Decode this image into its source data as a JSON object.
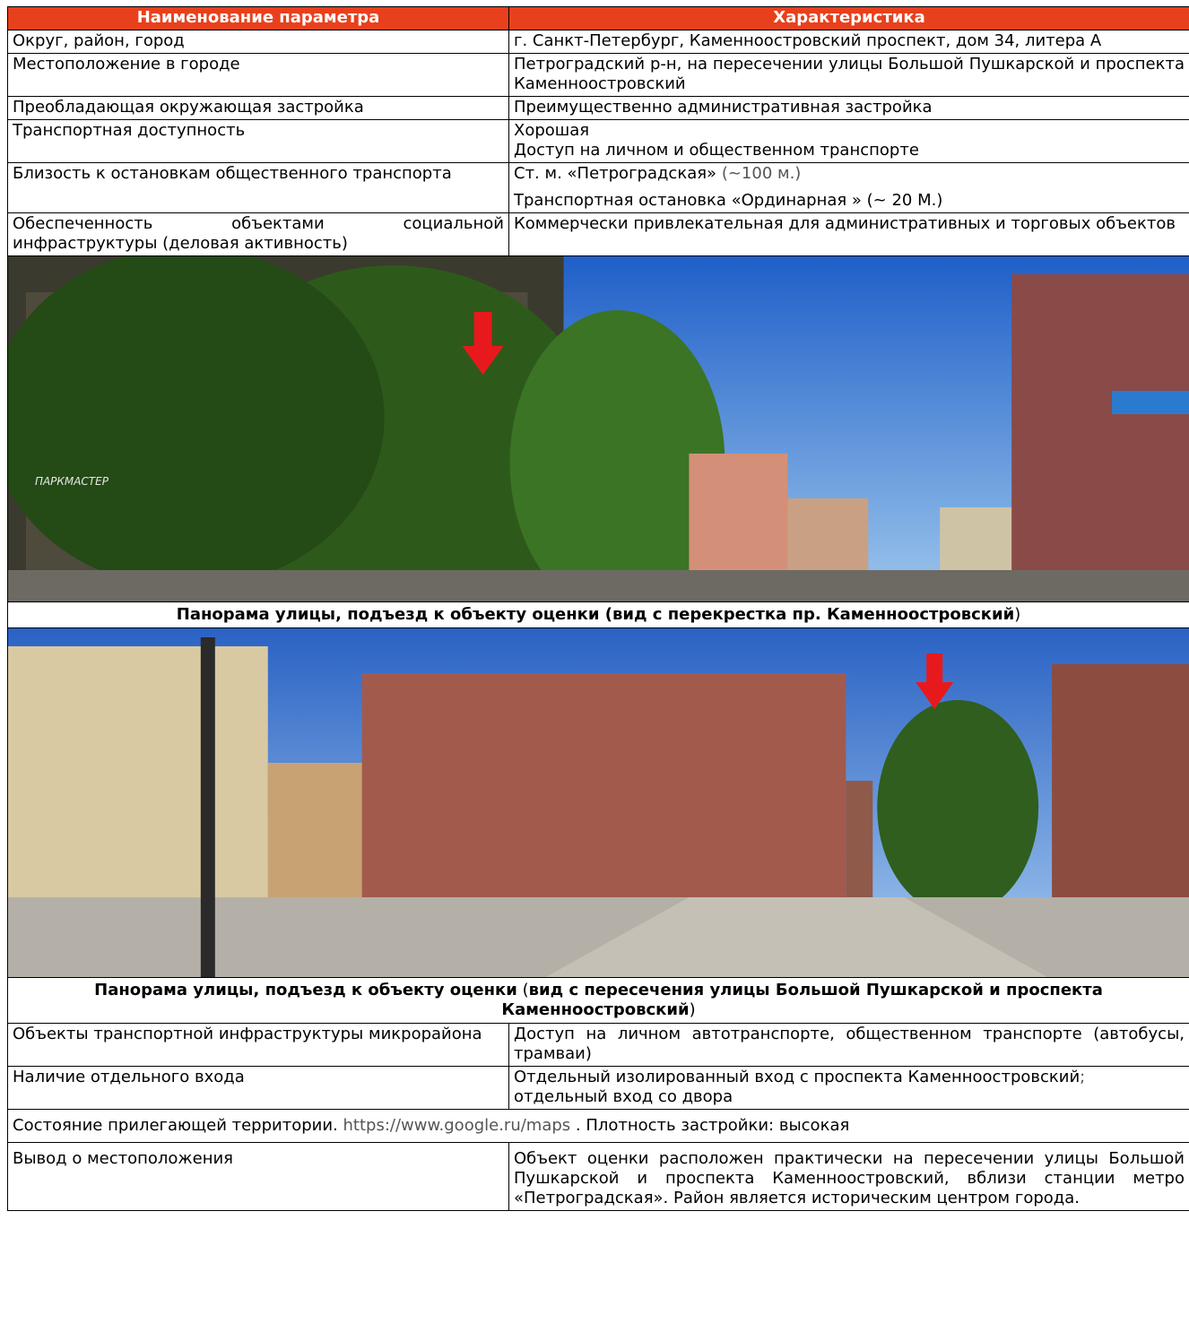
{
  "header": {
    "col1": "Наименование параметра",
    "col2": "Характеристика"
  },
  "rows_top": [
    {
      "param": "Округ, район, город",
      "value": "г. Санкт-Петербург, Каменноостровский проспект, дом 34, литера А"
    },
    {
      "param": "Местоположение в городе",
      "value": "Петроградский р-н, на пересечении улицы Большой Пушкарской  и проспекта Каменноостровский"
    },
    {
      "param": "Преобладающая окружающая застройка",
      "value": "Преимущественно  административная застройка"
    },
    {
      "param": "Транспортная доступность",
      "value_line1": "Хорошая",
      "value_line2": "Доступ на личном и общественном транспорте"
    },
    {
      "param": "Близость к остановкам общественного транспорта",
      "value_line1": "Ст. м. «Петроградская»",
      "value_line1_note": "(~100 м.)",
      "value_line2": "Транспортная остановка «Ординарная » (~ 20 М.)"
    },
    {
      "param": "Обеспеченность объектами социальной инфраструктуры (деловая активность)",
      "value": "Коммерчески привлекательная для административных и торговых объектов"
    }
  ],
  "photo1": {
    "caption": "Панорама улицы, подъезд к объекту оценки (вид с перекрестка пр. Каменноостровский",
    "caption_tail": ")",
    "sign_text": "ПАРКМАСТЕР"
  },
  "photo2": {
    "caption_part1": "Панорама улицы, подъезд к объекту оценки",
    "caption_part2": " (",
    "caption_part3": "вид с пересечения улицы Большой Пушкарской  и проспекта Каменноостровский",
    "caption_part4": ")"
  },
  "rows_bottom": [
    {
      "param": "Объекты транспортной инфраструктуры микрорайона",
      "value": "Доступ на личном автотранспорте, общественном транспорте (автобусы, трамваи)"
    },
    {
      "param": "Наличие отдельного входа",
      "value": "Отдельный изолированный вход с проспекта  Каменноостровский",
      "value_sep": ";",
      "value_line2": "отдельный вход со двора"
    }
  ],
  "territory": {
    "part1": "Состояние прилегающей территории. ",
    "url": " https://www.google.ru/maps",
    "part2": " . Плотность застройки: высокая"
  },
  "conclusion": {
    "param": "Вывод о местоположения",
    "value": "Объект оценки расположен практически на пересечении улицы Большой Пушкарской и проспекта Каменноостровский, вблизи станции метро «Петроградская». Район является историческим центром города."
  },
  "colors": {
    "header_bg": "#e8401c",
    "arrow": "#e8191c"
  }
}
